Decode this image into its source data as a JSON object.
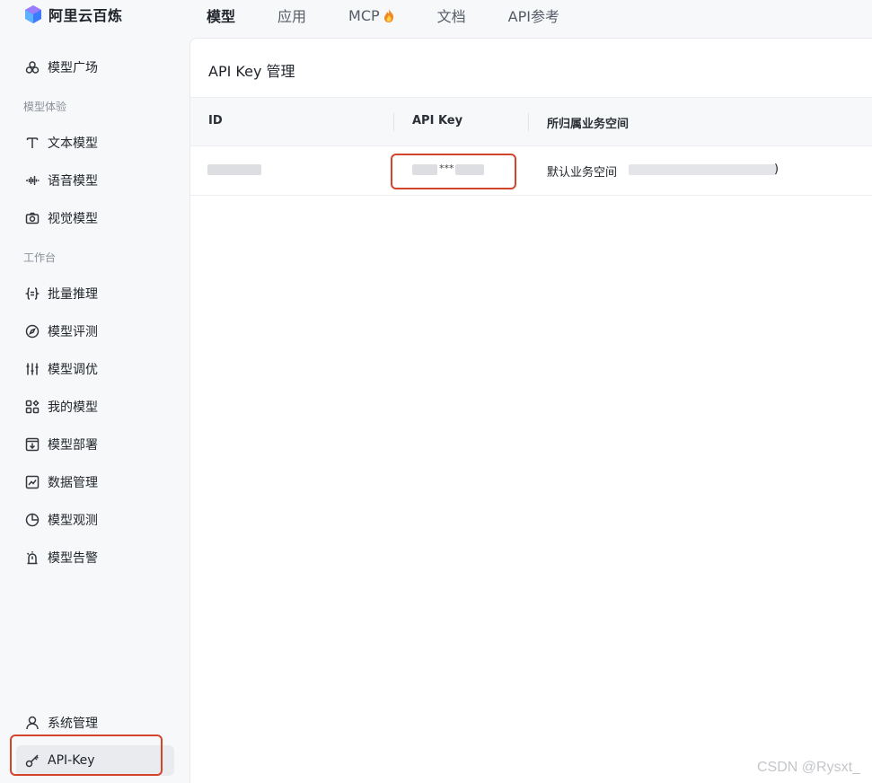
{
  "app": {
    "brand_name": "阿里云百炼"
  },
  "topnav": [
    {
      "label": "模型",
      "active": true
    },
    {
      "label": "应用",
      "active": false
    },
    {
      "label": "MCP",
      "active": false,
      "icon": "flame-icon"
    },
    {
      "label": "文档",
      "active": false
    },
    {
      "label": "API参考",
      "active": false
    }
  ],
  "sidebar": {
    "top_item": {
      "label": "模型广场",
      "icon": "cluster-icon"
    },
    "group1_label": "模型体验",
    "group1": [
      {
        "label": "文本模型",
        "icon": "text-icon"
      },
      {
        "label": "语音模型",
        "icon": "audio-wave-icon"
      },
      {
        "label": "视觉模型",
        "icon": "camera-icon"
      }
    ],
    "group2_label": "工作台",
    "group2": [
      {
        "label": "批量推理",
        "icon": "braces-icon"
      },
      {
        "label": "模型评测",
        "icon": "compass-icon"
      },
      {
        "label": "模型调优",
        "icon": "sliders-icon"
      },
      {
        "label": "我的模型",
        "icon": "grid-icon"
      },
      {
        "label": "模型部署",
        "icon": "download-box-icon"
      },
      {
        "label": "数据管理",
        "icon": "chart-icon"
      },
      {
        "label": "模型观测",
        "icon": "pie-icon"
      },
      {
        "label": "模型告警",
        "icon": "alarm-icon"
      }
    ],
    "bottom": [
      {
        "label": "系统管理",
        "icon": "user-icon"
      },
      {
        "label": "API-Key",
        "icon": "key-icon",
        "active": true
      }
    ]
  },
  "main": {
    "title": "API Key 管理",
    "columns": [
      "ID",
      "API Key",
      "所归属业务空间"
    ],
    "rows": [
      {
        "key_masked": "***",
        "workspace": "默认业务空间",
        "workspace_suffix": ")"
      }
    ]
  },
  "watermark": "CSDN @Rysxt_",
  "colors": {
    "highlight": "#d2452c",
    "background": "#f7f8fa"
  }
}
